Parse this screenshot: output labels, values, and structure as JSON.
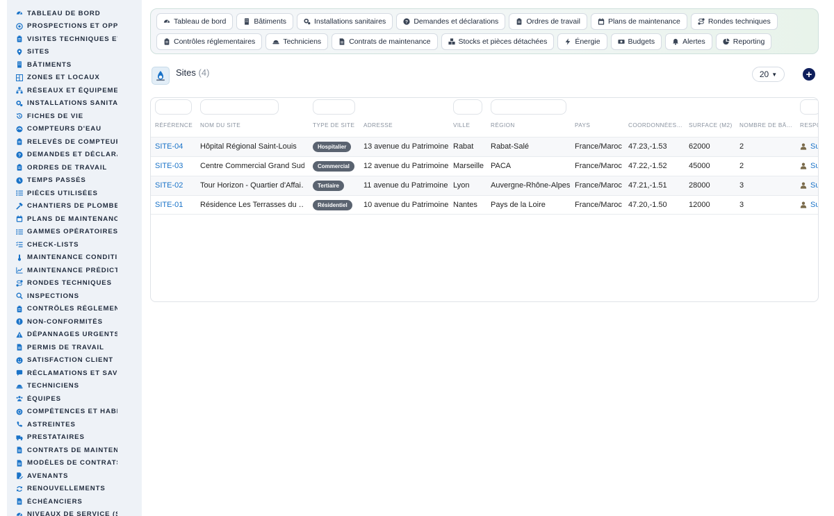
{
  "sidebar": {
    "items": [
      {
        "label": "Tableau de bord",
        "icon": "gauge-icon"
      },
      {
        "label": "Prospections et opportunités",
        "icon": "target-icon"
      },
      {
        "label": "Visites techniques et audits",
        "icon": "clipboard-icon"
      },
      {
        "label": "Sites",
        "icon": "map-pin-icon"
      },
      {
        "label": "Bâtiments",
        "icon": "building-icon"
      },
      {
        "label": "Zones et locaux",
        "icon": "zones-icon"
      },
      {
        "label": "Réseaux et équipements",
        "icon": "network-icon"
      },
      {
        "label": "Installations sanitaires",
        "icon": "cogs-icon"
      },
      {
        "label": "Fiches de vie",
        "icon": "history-icon"
      },
      {
        "label": "Compteurs d'eau",
        "icon": "meter-icon"
      },
      {
        "label": "Relevés de compteurs",
        "icon": "clipboard-icon"
      },
      {
        "label": "Demandes et déclarations",
        "icon": "question-icon"
      },
      {
        "label": "Ordres de travail",
        "icon": "clipboard-icon"
      },
      {
        "label": "Temps passés",
        "icon": "clock-icon"
      },
      {
        "label": "Pièces utilisées",
        "icon": "list-icon"
      },
      {
        "label": "Chantiers de plomberie",
        "icon": "hammer-icon"
      },
      {
        "label": "Plans de maintenance",
        "icon": "calendar-icon"
      },
      {
        "label": "Gammes opératoires",
        "icon": "list-icon"
      },
      {
        "label": "Check-lists",
        "icon": "checklist-icon"
      },
      {
        "label": "Maintenance conditionnelle",
        "icon": "thermometer-icon"
      },
      {
        "label": "Maintenance prédictive",
        "icon": "chart-line-icon"
      },
      {
        "label": "Rondes techniques",
        "icon": "route-icon"
      },
      {
        "label": "Inspections",
        "icon": "search-icon"
      },
      {
        "label": "Contrôles réglementaires",
        "icon": "clipboard-icon"
      },
      {
        "label": "Non-conformités",
        "icon": "alert-circle-icon"
      },
      {
        "label": "Dépannages urgents",
        "icon": "warning-icon"
      },
      {
        "label": "Permis de travail",
        "icon": "file-icon"
      },
      {
        "label": "Satisfaction client",
        "icon": "smile-icon"
      },
      {
        "label": "Réclamations et SAV",
        "icon": "comment-icon"
      },
      {
        "label": "Techniciens",
        "icon": "helmet-icon"
      },
      {
        "label": "Équipes",
        "icon": "users-icon"
      },
      {
        "label": "Compétences et habilitations",
        "icon": "certificate-icon"
      },
      {
        "label": "Astreintes",
        "icon": "phone-icon"
      },
      {
        "label": "Prestataires",
        "icon": "truck-icon"
      },
      {
        "label": "Contrats de maintenance",
        "icon": "file-icon"
      },
      {
        "label": "Modèles de contrats",
        "icon": "file-icon"
      },
      {
        "label": "Avenants",
        "icon": "file-pen-icon"
      },
      {
        "label": "Renouvellements",
        "icon": "refresh-icon"
      },
      {
        "label": "Échéanciers",
        "icon": "file-icon"
      },
      {
        "label": "Niveaux de service (SLA)",
        "icon": "gauge-icon"
      }
    ]
  },
  "topnav": {
    "row1": [
      {
        "label": "Tableau de bord",
        "icon": "gauge-icon"
      },
      {
        "label": "Bâtiments",
        "icon": "building-icon"
      },
      {
        "label": "Installations sanitaires",
        "icon": "cogs-icon"
      },
      {
        "label": "Demandes et déclarations",
        "icon": "question-icon"
      },
      {
        "label": "Ordres de travail",
        "icon": "clipboard-icon"
      },
      {
        "label": "Plans de maintenance",
        "icon": "calendar-icon"
      },
      {
        "label": "Rondes techniques",
        "icon": "route-icon"
      }
    ],
    "row2": [
      {
        "label": "Contrôles réglementaires",
        "icon": "clipboard-icon"
      },
      {
        "label": "Techniciens",
        "icon": "helmet-icon"
      },
      {
        "label": "Contrats de maintenance",
        "icon": "file-icon"
      },
      {
        "label": "Stocks et pièces détachées",
        "icon": "boxes-icon"
      },
      {
        "label": "Énergie",
        "icon": "bolt-icon"
      },
      {
        "label": "Budgets",
        "icon": "money-icon"
      },
      {
        "label": "Alertes",
        "icon": "bell-icon"
      },
      {
        "label": "Reporting",
        "icon": "pie-icon"
      }
    ]
  },
  "header": {
    "title": "Sites",
    "count": "(4)",
    "per_page": "20"
  },
  "table": {
    "columns": [
      "Référence",
      "Nom du site",
      "Type de site",
      "Adresse",
      "Ville",
      "Région",
      "Pays",
      "Coordonnées…",
      "Surface (m2)",
      "Nombre de bâ…",
      "Respo"
    ],
    "rows": [
      {
        "ref": "SITE-04",
        "name": "Hôpital Régional Saint-Louis",
        "type": "Hospitalier",
        "address": "13 avenue du Patrimoine",
        "city": "Rabat",
        "region": "Rabat-Salé",
        "country": "France/Maroc",
        "coords": "47.23,-1.53",
        "surface": "62000",
        "buildings": "2",
        "resp": "Su"
      },
      {
        "ref": "SITE-03",
        "name": "Centre Commercial Grand Sud",
        "type": "Commercial",
        "address": "12 avenue du Patrimoine",
        "city": "Marseille",
        "region": "PACA",
        "country": "France/Maroc",
        "coords": "47.22,-1.52",
        "surface": "45000",
        "buildings": "2",
        "resp": "Su"
      },
      {
        "ref": "SITE-02",
        "name": "Tour Horizon - Quartier d'Affai…",
        "type": "Tertiaire",
        "address": "11 avenue du Patrimoine",
        "city": "Lyon",
        "region": "Auvergne-Rhône-Alpes",
        "country": "France/Maroc",
        "coords": "47.21,-1.51",
        "surface": "28000",
        "buildings": "3",
        "resp": "Su"
      },
      {
        "ref": "SITE-01",
        "name": "Résidence Les Terrasses du …",
        "type": "Résidentiel",
        "address": "10 avenue du Patrimoine",
        "city": "Nantes",
        "region": "Pays de la Loire",
        "country": "France/Maroc",
        "coords": "47.20,-1.50",
        "surface": "12000",
        "buildings": "3",
        "resp": "Su"
      }
    ]
  },
  "colors": {
    "accent": "#1a73c8",
    "sidebar_bg": "#eef2f7",
    "icon": "#1a73c8",
    "badge": "#5a6370",
    "add_button": "#0f1f5c"
  }
}
